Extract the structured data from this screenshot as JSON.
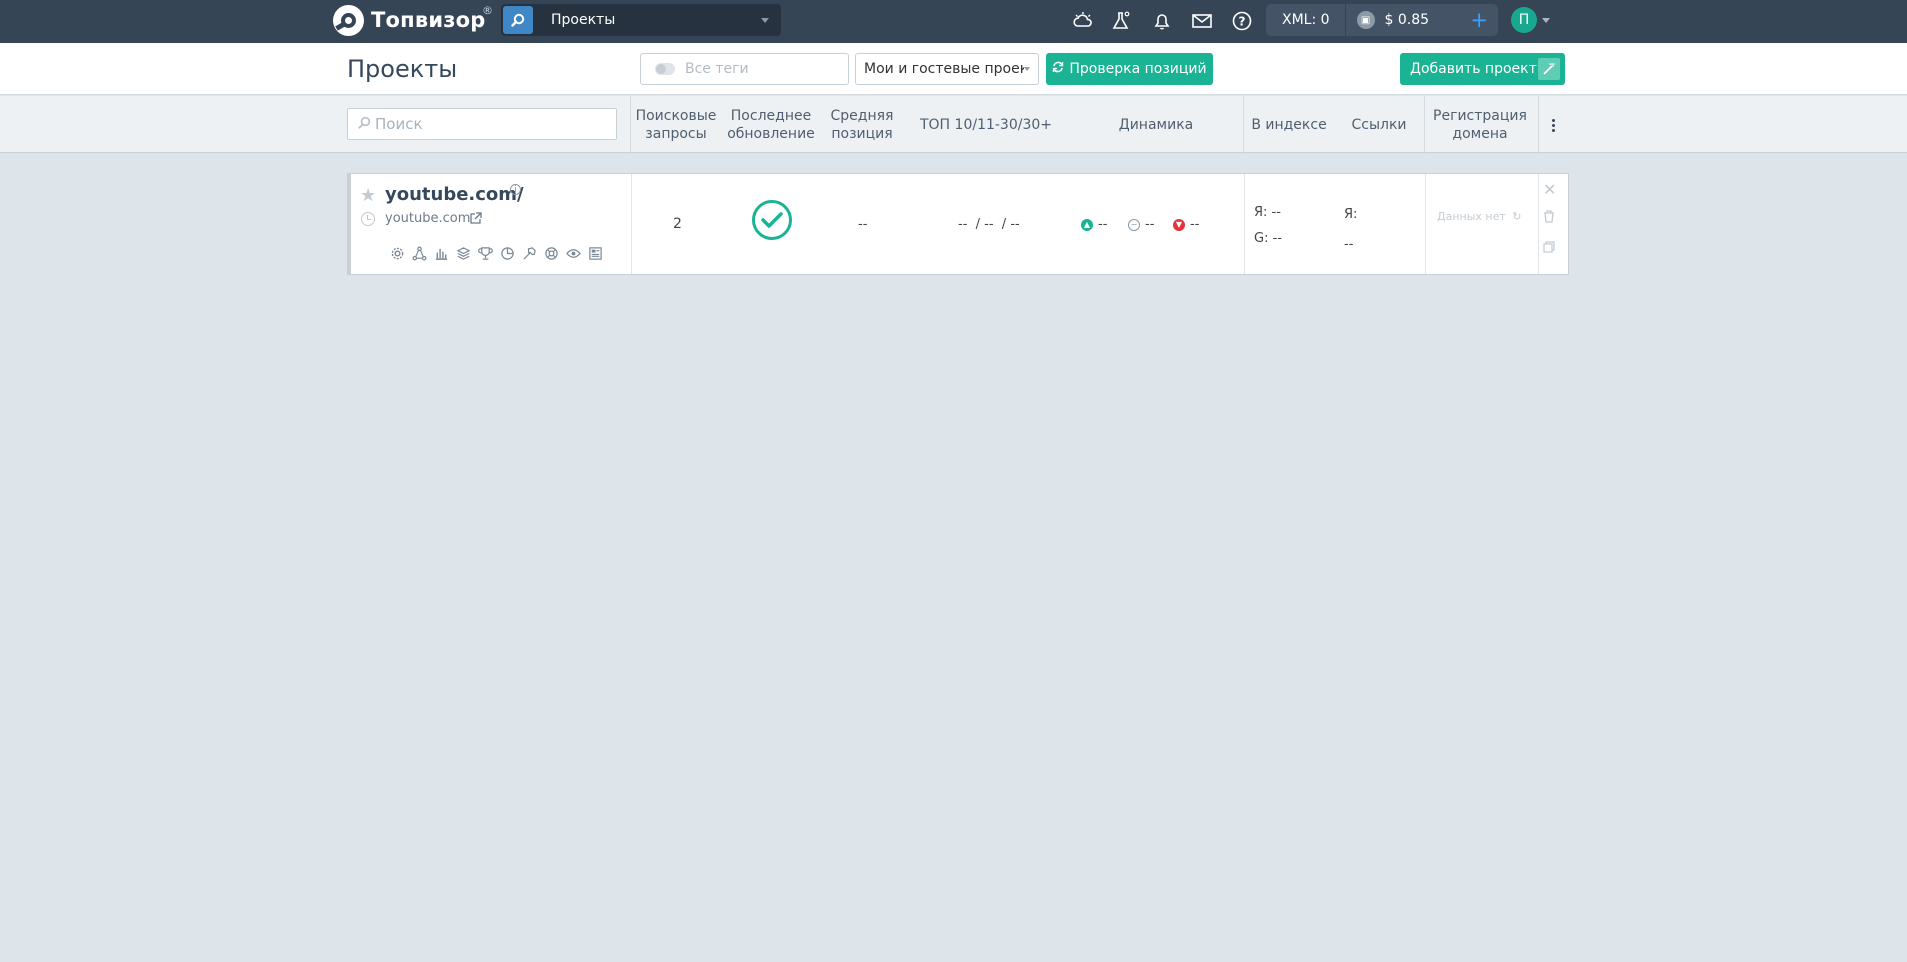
{
  "app": {
    "logo_text": "Топвизор",
    "logo_reg": "®",
    "project_select": "Проекты"
  },
  "topbar": {
    "icons": [
      "weather-icon",
      "lab-icon",
      "bell-icon",
      "mail-icon",
      "help-icon"
    ],
    "xml_label": "XML: 0",
    "balance": "$ 0.85",
    "add_funds": "+",
    "avatar_letter": "П"
  },
  "header": {
    "title": "Проекты",
    "tags_placeholder": "Все теги",
    "filter_value": "Мои и гостевые проекты",
    "check_button": "Проверка позиций",
    "add_button": "Добавить проект"
  },
  "columns": {
    "search_placeholder": "Поиск",
    "queries": "Поисковые запросы",
    "last_update": "Последнее обновление",
    "avg_position": "Средняя позиция",
    "top": "ТОП 10/11-30/30+",
    "dynamics": "Динамика",
    "in_index": "В индексе",
    "links": "Ссылки",
    "domain_reg": "Регистрация домена"
  },
  "project": {
    "name": "youtube.com/",
    "url": "youtube.com",
    "queries_count": "2",
    "avg_position": "--",
    "top_values": "--  / --  / --",
    "dyn_up": "--",
    "dyn_same": "--",
    "dyn_down": "--",
    "index_yandex": "Я: --",
    "index_google": "G: --",
    "links_label": "Я:",
    "links_value": "--",
    "domain_reg": "Данных нет",
    "tools": [
      "settings-icon",
      "network-icon",
      "chart-icon",
      "layers-icon",
      "trophy-icon",
      "pie-icon",
      "target-icon",
      "hammer-icon",
      "lifebuoy-icon",
      "eye-icon",
      "report-icon"
    ]
  },
  "colors": {
    "topbar": "#364556",
    "accent": "#1ab394",
    "up": "#1ab394",
    "down": "#e5343d",
    "neutral": "#8a97a4"
  }
}
